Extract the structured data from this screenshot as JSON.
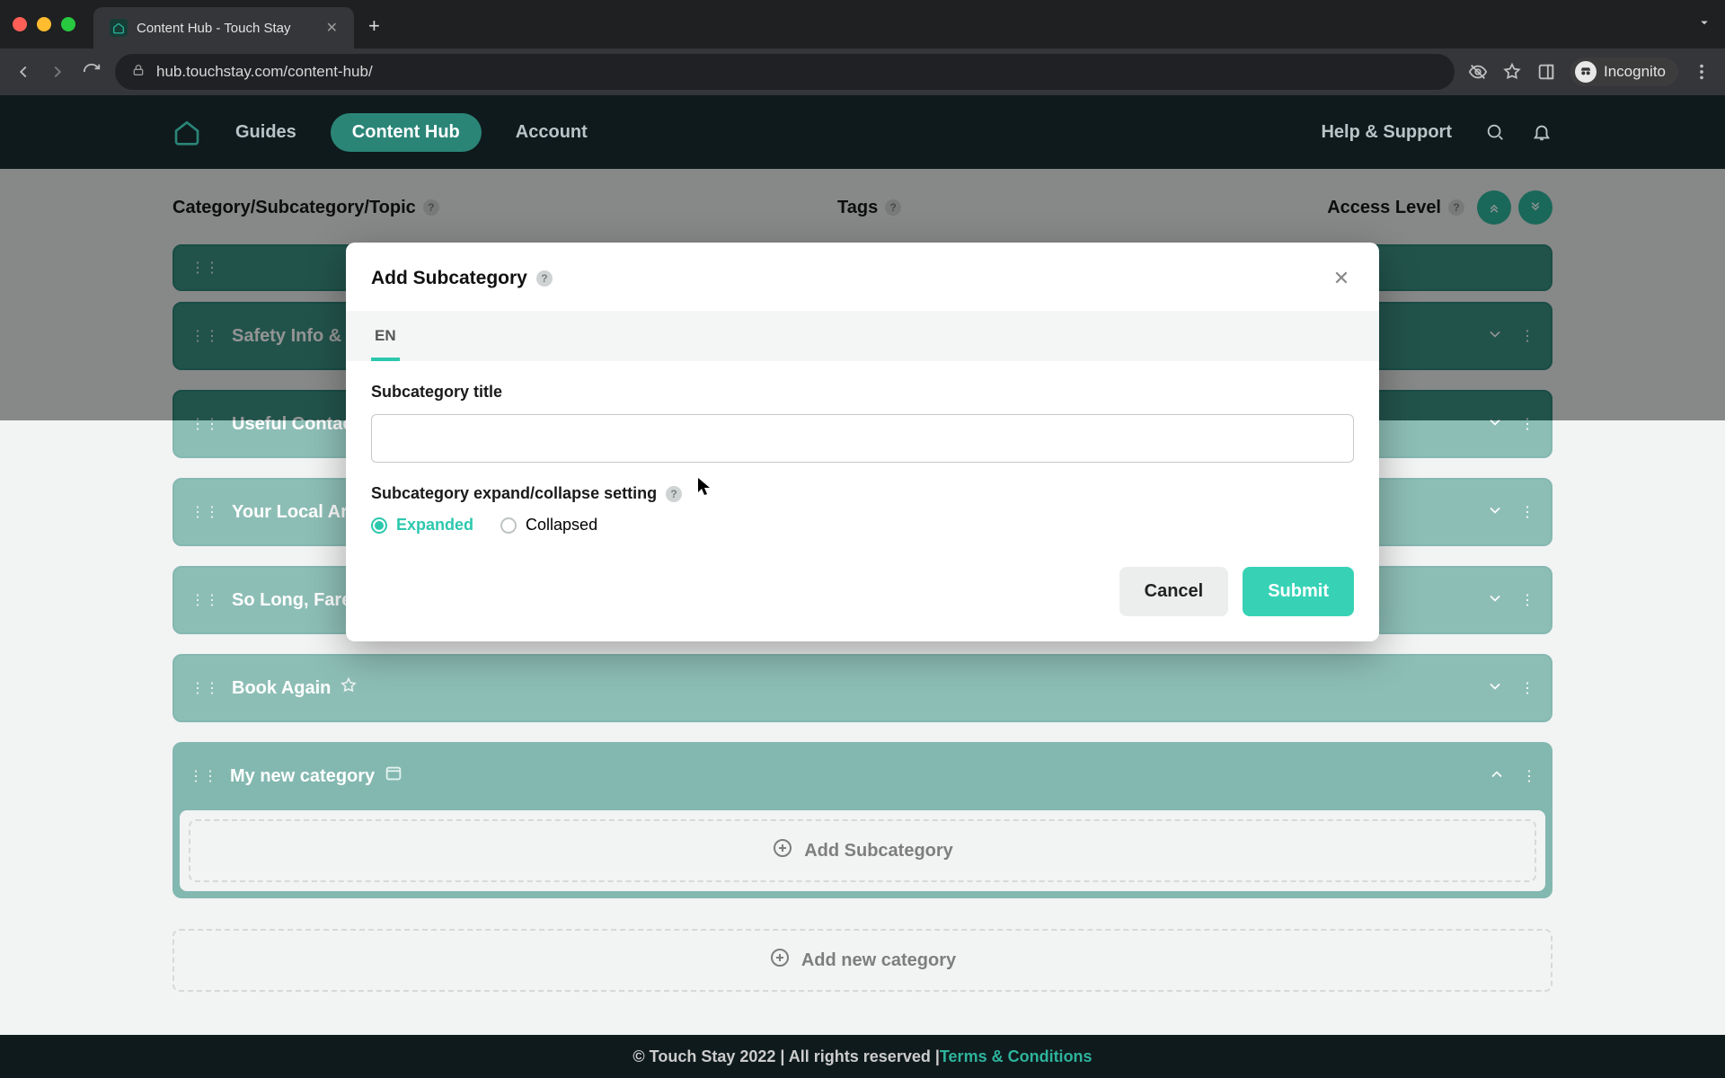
{
  "browser": {
    "tab_title": "Content Hub - Touch Stay",
    "url": "hub.touchstay.com/content-hub/",
    "incognito_label": "Incognito"
  },
  "nav": {
    "items": [
      "Guides",
      "Content Hub",
      "Account"
    ],
    "active_index": 1,
    "help_label": "Help & Support"
  },
  "columns": {
    "a": "Category/Subcategory/Topic",
    "b": "Tags",
    "c": "Access Level"
  },
  "categories": [
    {
      "title": "Safety Info & Ru"
    },
    {
      "title": "Useful Contact "
    },
    {
      "title": "Your Local Area"
    },
    {
      "title": "So Long, Farew"
    },
    {
      "title": "Book Again"
    },
    {
      "title": "My new category",
      "open": true
    }
  ],
  "add_subcategory_label": "Add Subcategory",
  "add_category_label": "Add new category",
  "modal": {
    "title": "Add Subcategory",
    "lang_tab": "EN",
    "field_title_label": "Subcategory title",
    "title_value": "",
    "expand_label": "Subcategory expand/collapse setting",
    "radio_expanded": "Expanded",
    "radio_collapsed": "Collapsed",
    "cancel": "Cancel",
    "submit": "Submit"
  },
  "footer": {
    "text_left": "© Touch Stay 2022 | All rights reserved | ",
    "link": "Terms & Conditions"
  }
}
